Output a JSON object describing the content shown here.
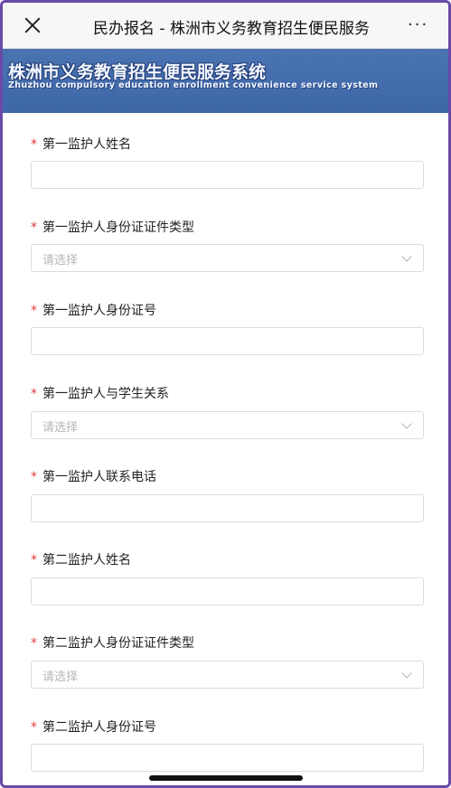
{
  "nav": {
    "title": "民办报名 - 株洲市义务教育招生便民服务系统",
    "more": "···"
  },
  "banner": {
    "title_cn": "株洲市义务教育招生便民服务系统",
    "title_en": "Zhuzhou compulsory education enrollment convenience service system"
  },
  "form": {
    "required_mark": "*",
    "fields": [
      {
        "label": "第一监护人姓名",
        "type": "input",
        "value": ""
      },
      {
        "label": "第一监护人身份证证件类型",
        "type": "select",
        "placeholder": "请选择"
      },
      {
        "label": "第一监护人身份证号",
        "type": "input",
        "value": ""
      },
      {
        "label": "第一监护人与学生关系",
        "type": "select",
        "placeholder": "请选择"
      },
      {
        "label": "第一监护人联系电话",
        "type": "input",
        "value": ""
      },
      {
        "label": "第二监护人姓名",
        "type": "input",
        "value": ""
      },
      {
        "label": "第二监护人身份证证件类型",
        "type": "select",
        "placeholder": "请选择"
      },
      {
        "label": "第二监护人身份证号",
        "type": "input",
        "value": ""
      }
    ]
  }
}
